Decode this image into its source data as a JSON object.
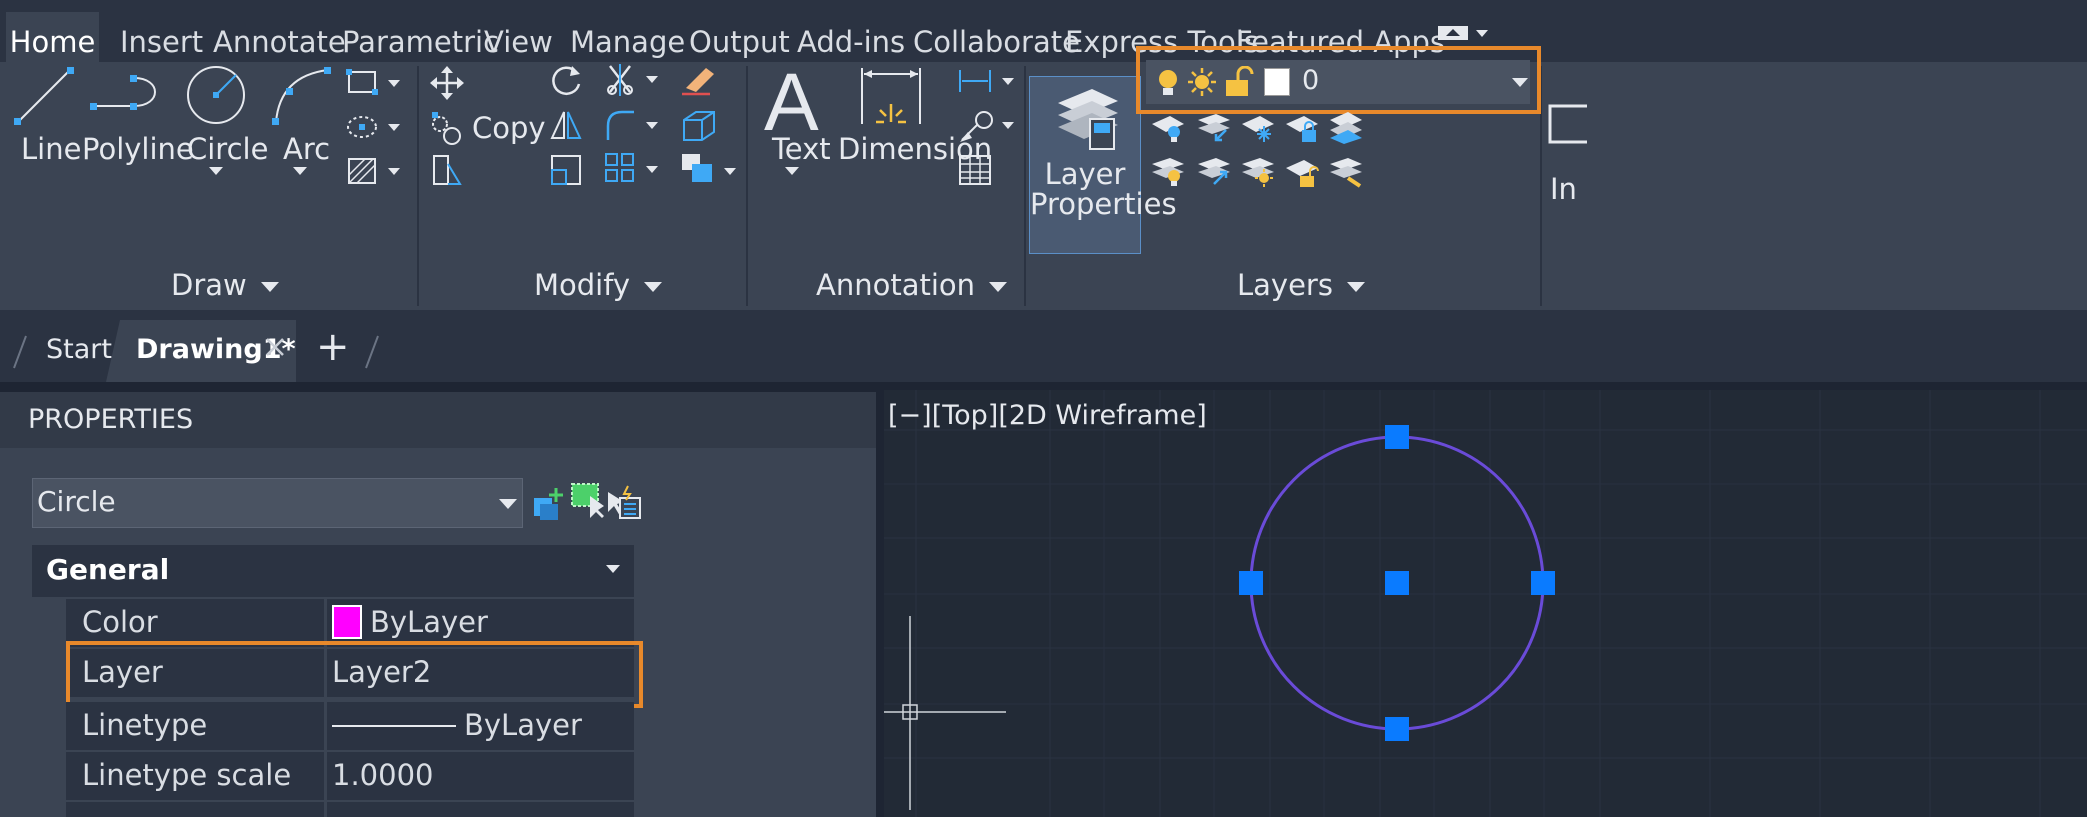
{
  "ribbon_tabs": [
    "Home",
    "Insert",
    "Annotate",
    "Parametric",
    "View",
    "Manage",
    "Output",
    "Add-ins",
    "Collaborate",
    "Express Tools",
    "Featured Apps"
  ],
  "draw": {
    "line": "Line",
    "polyline": "Polyline",
    "circle": "Circle",
    "arc": "Arc",
    "group": "Draw"
  },
  "modify": {
    "copy": "Copy",
    "group": "Modify"
  },
  "annotation": {
    "text": "Text",
    "dimension": "Dimension",
    "group": "Annotation"
  },
  "layers": {
    "properties_line1": "Layer",
    "properties_line2": "Properties",
    "current_layer": "0",
    "group": "Layers"
  },
  "partial_next": "In",
  "doc_tabs": {
    "start": "Start",
    "drawing": "Drawing1*",
    "new": "+"
  },
  "properties": {
    "title": "PROPERTIES",
    "selector": "Circle",
    "section": "General",
    "rows": [
      {
        "label": "Color",
        "value": "ByLayer"
      },
      {
        "label": "Layer",
        "value": "Layer2"
      },
      {
        "label": "Linetype",
        "value": "ByLayer"
      },
      {
        "label": "Linetype scale",
        "value": "1.0000"
      }
    ]
  },
  "viewport": {
    "label": "[−][Top][2D Wireframe]"
  },
  "colors": {
    "accent": "#e8892b",
    "grip": "#0a7bff",
    "circle": "#6a4bd8",
    "layer_color": "#ff00ff"
  }
}
